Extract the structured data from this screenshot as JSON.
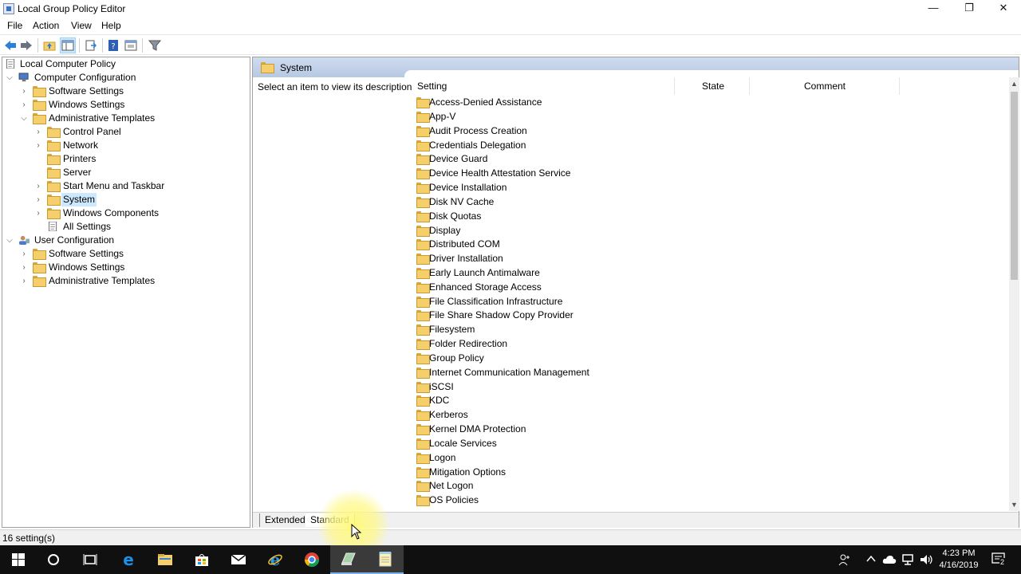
{
  "window": {
    "title": "Local Group Policy Editor",
    "minimize_glyph": "—",
    "restore_glyph": "❐",
    "close_glyph": "✕"
  },
  "menu": [
    "File",
    "Action",
    "View",
    "Help"
  ],
  "toolbar": {
    "icons": [
      "back-icon",
      "forward-icon",
      "up-folder-icon",
      "show-hide-tree-icon",
      "export-list-icon",
      "help-icon",
      "properties-icon",
      "filter-icon"
    ]
  },
  "tree": {
    "root": "Local Computer Policy",
    "computer_config": "Computer Configuration",
    "cc_software": "Software Settings",
    "cc_windows": "Windows Settings",
    "cc_admin": "Administrative Templates",
    "control_panel": "Control Panel",
    "network": "Network",
    "printers": "Printers",
    "server": "Server",
    "start_menu": "Start Menu and Taskbar",
    "system": "System",
    "windows_components": "Windows Components",
    "all_settings": "All Settings",
    "user_config": "User Configuration",
    "uc_software": "Software Settings",
    "uc_windows": "Windows Settings",
    "uc_admin": "Administrative Templates"
  },
  "right": {
    "header_title": "System",
    "description": "Select an item to view its description.",
    "columns": [
      "Setting",
      "State",
      "Comment"
    ],
    "items": [
      "Access-Denied Assistance",
      "App-V",
      "Audit Process Creation",
      "Credentials Delegation",
      "Device Guard",
      "Device Health Attestation Service",
      "Device Installation",
      "Disk NV Cache",
      "Disk Quotas",
      "Display",
      "Distributed COM",
      "Driver Installation",
      "Early Launch Antimalware",
      "Enhanced Storage Access",
      "File Classification Infrastructure",
      "File Share Shadow Copy Provider",
      "Filesystem",
      "Folder Redirection",
      "Group Policy",
      "Internet Communication Management",
      "iSCSI",
      "KDC",
      "Kerberos",
      "Kernel DMA Protection",
      "Locale Services",
      "Logon",
      "Mitigation Options",
      "Net Logon",
      "OS Policies"
    ],
    "tabs": [
      "Extended",
      "Standard"
    ],
    "active_tab": "Standard"
  },
  "status": {
    "text": "16 setting(s)"
  },
  "taskbar": {
    "apps": [
      "start-icon",
      "cortana-icon",
      "task-view-icon",
      "edge-icon",
      "file-explorer-icon",
      "store-icon",
      "mail-icon",
      "internet-explorer-icon",
      "chrome-icon",
      "mmc-icon",
      "notepad-icon"
    ],
    "time": "4:23 PM",
    "date": "4/16/2019",
    "notification_count": "2"
  },
  "colors": {
    "header_blue": "#b7c8e3",
    "selection": "#cce8ff",
    "folder": "#f4cf6c",
    "taskbar": "#101010"
  }
}
